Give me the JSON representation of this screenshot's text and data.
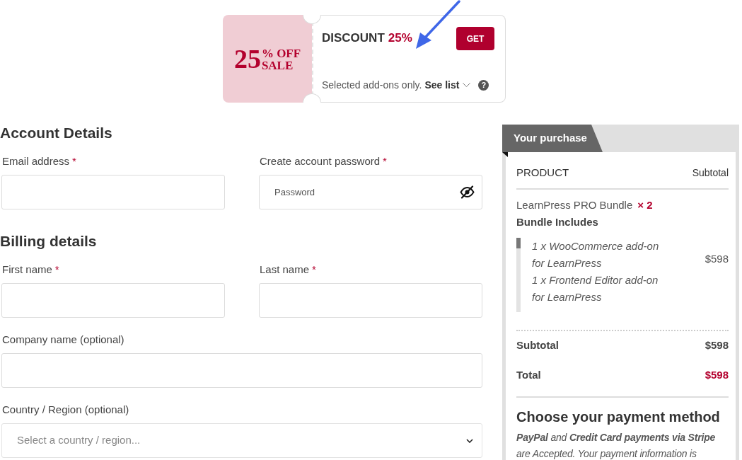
{
  "coupon": {
    "badge": {
      "number": "25",
      "suffix": "% OFF",
      "word": "SALE"
    },
    "title": "DISCOUNT",
    "title_value": "25%",
    "button": "GET",
    "note": "Selected add-ons only.",
    "link": "See list",
    "help": "?"
  },
  "sections": [
    {
      "heading": "Account Details",
      "rows": [
        [
          {
            "kind": "text",
            "label": "Email address",
            "required_mark": "*"
          },
          {
            "kind": "password",
            "label": "Create account password",
            "required_mark": "*",
            "placeholder": "Password"
          }
        ]
      ]
    },
    {
      "heading": "Billing details",
      "rows": [
        [
          {
            "kind": "text",
            "label": "First name",
            "required_mark": "*"
          },
          {
            "kind": "text",
            "label": "Last name",
            "required_mark": "*"
          }
        ],
        [
          {
            "kind": "text",
            "label": "Company name (optional)"
          }
        ],
        [
          {
            "kind": "select",
            "label": "Country / Region (optional)",
            "placeholder": "Select a country / region..."
          }
        ]
      ]
    }
  ],
  "order": {
    "tab": "Your purchase",
    "columns": [
      "PRODUCT",
      "Subtotal"
    ],
    "items": [
      {
        "name": "LearnPress PRO Bundle",
        "quantity": "× 2",
        "includes_label": "Bundle Includes",
        "includes": [
          "1 x WooCommerce add-on for LearnPress",
          "1 x Frontend Editor add-on for LearnPress"
        ],
        "subtotal": "$598"
      }
    ],
    "totals": [
      {
        "kind": "subtotal",
        "label": "Subtotal",
        "value": "$598"
      },
      {
        "kind": "total",
        "label": "Total",
        "value": "$598"
      }
    ],
    "payment": {
      "heading": "Choose your payment method",
      "note": "**PayPal** and **Credit Card payments via Stripe** are Accepted. Your payment information is"
    }
  }
}
